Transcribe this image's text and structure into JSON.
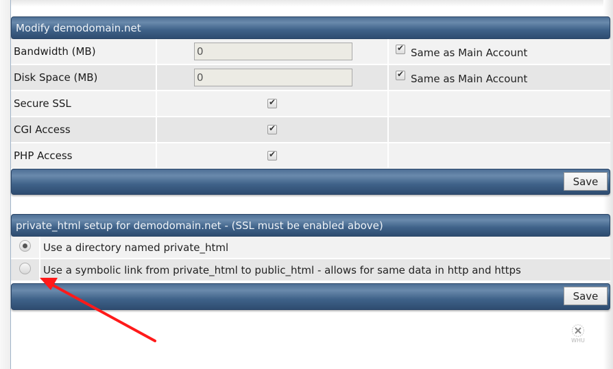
{
  "modify_panel": {
    "title": "Modify demodomain.net",
    "rows": [
      {
        "label": "Bandwidth (MB)",
        "type": "input",
        "value": "0",
        "same_as_checked": true,
        "same_as_label": "Same as Main Account"
      },
      {
        "label": "Disk Space (MB)",
        "type": "input",
        "value": "0",
        "same_as_checked": true,
        "same_as_label": "Same as Main Account"
      },
      {
        "label": "Secure SSL",
        "type": "checkbox",
        "checked": true
      },
      {
        "label": "CGI Access",
        "type": "checkbox",
        "checked": true
      },
      {
        "label": "PHP Access",
        "type": "checkbox",
        "checked": true
      }
    ],
    "save_label": "Save"
  },
  "private_html_panel": {
    "title": "private_html setup for demodomain.net - (SSL must be enabled above)",
    "options": [
      {
        "label": "Use a directory named private_html",
        "selected": true
      },
      {
        "label": "Use a symbolic link from private_html to public_html - allows for same data in http and https",
        "selected": false
      }
    ],
    "save_label": "Save"
  },
  "annotation": {
    "type": "arrow",
    "color": "#ff0000",
    "points_to": "symbolic-link-radio"
  },
  "logo": {
    "text": "WHU"
  },
  "colors": {
    "header_bar": "#3f6289",
    "row_light": "#f2f2f2",
    "row_dark": "#e6e6e6",
    "input_bg": "#ecebe4"
  }
}
